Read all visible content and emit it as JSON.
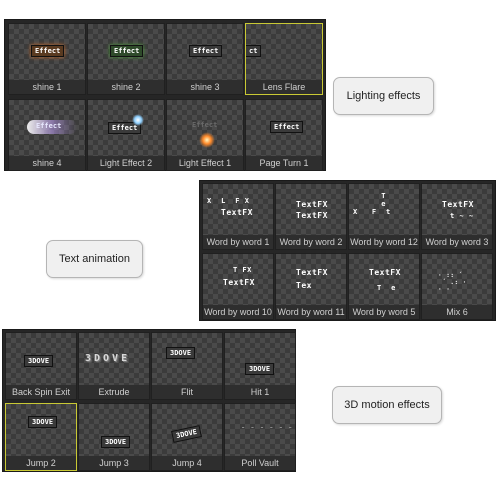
{
  "lighting": {
    "callout": "Lighting effects",
    "tiles": [
      {
        "caption": "shine 1"
      },
      {
        "caption": "shine 2"
      },
      {
        "caption": "shine 3"
      },
      {
        "caption": "Lens Flare"
      },
      {
        "caption": "shine 4"
      },
      {
        "caption": "Light Effect 2"
      },
      {
        "caption": "Light Effect 1"
      },
      {
        "caption": "Page Turn 1"
      }
    ],
    "thumb_text": "Effect",
    "thumb_text_short": "ct"
  },
  "text_animation": {
    "callout": "Text animation",
    "tiles": [
      {
        "caption": "Word by word 1"
      },
      {
        "caption": "Word by word 2"
      },
      {
        "caption": "Word by word 12"
      },
      {
        "caption": "Word by word 3"
      },
      {
        "caption": "Word by word 10"
      },
      {
        "caption": "Word by word 11"
      },
      {
        "caption": "Word by word 5"
      },
      {
        "caption": "Mix 6"
      }
    ],
    "thumb_text": "TextFX",
    "thumb_text_partial": "Tex"
  },
  "motion": {
    "callout": "3D motion effects",
    "tiles": [
      {
        "caption": "Back Spin Exit"
      },
      {
        "caption": "Extrude"
      },
      {
        "caption": "Flit"
      },
      {
        "caption": "Hit 1"
      },
      {
        "caption": "Jump 2"
      },
      {
        "caption": "Jump 3"
      },
      {
        "caption": "Jump 4"
      },
      {
        "caption": "Poll Vault"
      }
    ],
    "thumb_text": "3DOVE",
    "extrude_text": "3DOVE"
  },
  "colors": {
    "panel_bg": "#262626",
    "selected_border": "#c9c934",
    "caption_text": "#d0d0d0",
    "callout_bg": "#f0f0f0"
  }
}
